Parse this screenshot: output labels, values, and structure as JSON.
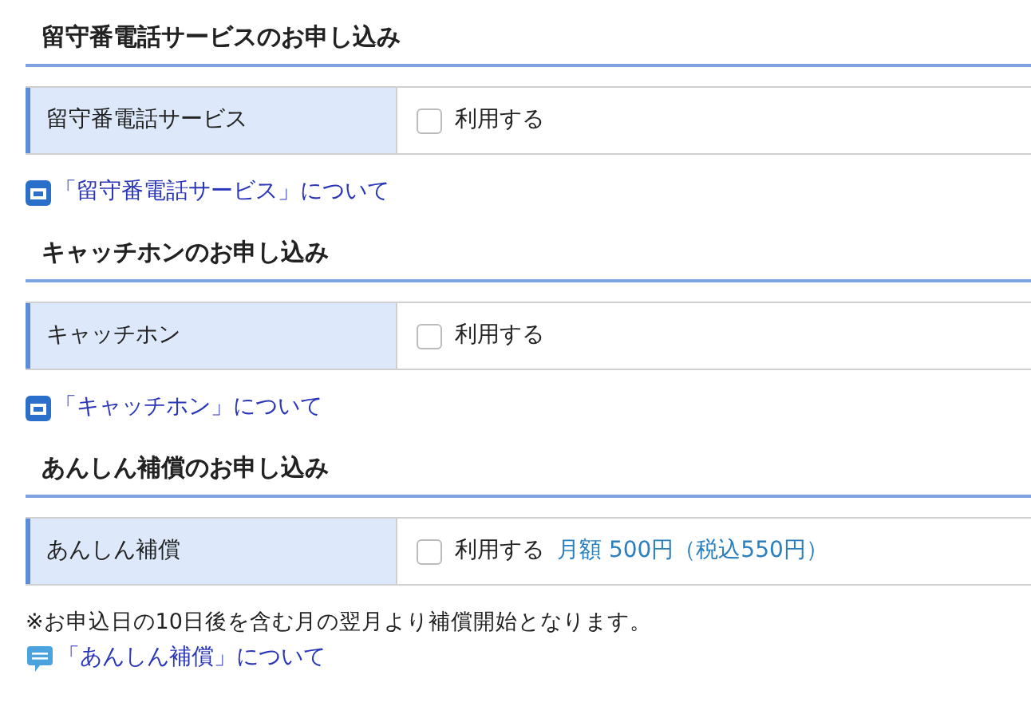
{
  "sections": [
    {
      "heading": "留守番電話サービスのお申し込み",
      "label": "留守番電話サービス",
      "option": {
        "label": "利用する",
        "checked": false
      },
      "links": [
        {
          "kind": "window",
          "text": "「留守番電話サービス」について"
        }
      ]
    },
    {
      "heading": "キャッチホンのお申し込み",
      "label": "キャッチホン",
      "option": {
        "label": "利用する",
        "checked": false
      },
      "links": [
        {
          "kind": "window",
          "text": "「キャッチホン」について"
        }
      ]
    },
    {
      "heading": "あんしん補償のお申し込み",
      "label": "あんしん補償",
      "option": {
        "label": "利用する",
        "checked": false
      },
      "price": "月額 500円（税込550円）",
      "note": "※お申込日の10日後を含む月の翌月より補償開始となります。",
      "links": [
        {
          "kind": "chat",
          "text": "「あんしん補償」について"
        }
      ]
    }
  ]
}
